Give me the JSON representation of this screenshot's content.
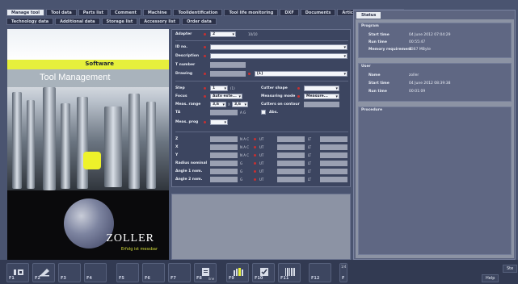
{
  "tabs_row1": [
    "Manage tool",
    "Tool data",
    "Parts list",
    "Comment",
    "Machine",
    "ToolIdentification",
    "Tool life monitoring",
    "DXF",
    "Documents",
    "Article characteristic bar"
  ],
  "tabs_row2": [
    "Technology data",
    "Additional data",
    "Storage list",
    "Accessory list",
    "Order data"
  ],
  "left": {
    "software_label": "Software",
    "title": "Tool Management",
    "logo": "ZOLLER",
    "slogan": "Erfolg ist messbar"
  },
  "form": {
    "adapter_label": "Adapter",
    "adapter_value": "2",
    "adapter_count": "10/10",
    "id_label": "ID no.",
    "description_label": "Description",
    "t_number_label": "T number",
    "drawing_label": "Drawing",
    "drawing_value": "[1]",
    "step_label": "Step",
    "step_value": "1",
    "step_count": "(1)",
    "focus_label": "Focus",
    "focus_value": "Auto exte...",
    "meas_range_label": "Meas. range",
    "meas_range_a": "3,6",
    "meas_range_x": "X",
    "meas_range_b": "3,6",
    "ta_label": "TA",
    "ta_suffix": "A G",
    "meas_prog_label": "Meas. prog",
    "cutter_shape_label": "Cutter shape",
    "measuring_mode_label": "Measuring mode",
    "measuring_mode_value": "Measure...",
    "cutters_contour_label": "Cutters on contour",
    "abs_label": "Abs.",
    "z_label": "Z",
    "x_label": "X",
    "y_label": "Y",
    "radius_label": "Radius nominal",
    "angle1_label": "Angle 1 nom.",
    "angle2_label": "Angle 2 nom.",
    "nac": "N A C",
    "ut": "UT",
    "lt": "LT",
    "g": "G"
  },
  "status": {
    "tab": "Status",
    "program_title": "Program",
    "program": [
      {
        "k": "Start time",
        "v": "04 June 2012 07:04:29"
      },
      {
        "k": "Run time",
        "v": "00:55:47"
      },
      {
        "k": "Memory requirement",
        "v": "1367 MByte"
      }
    ],
    "user_title": "User",
    "user": [
      {
        "k": "Name",
        "v": "zoller"
      },
      {
        "k": "Start time",
        "v": "04 June 2012 08:39:38"
      },
      {
        "k": "Run time",
        "v": "00:01:09"
      }
    ],
    "procedure_title": "Procedure"
  },
  "fkeys": [
    "F1",
    "F2",
    "F3",
    "F4",
    "F5",
    "F6",
    "F7",
    "F8",
    "F9",
    "F10",
    "F11",
    "F12",
    "F"
  ],
  "f8_sub": "line",
  "fsmall_top": "1/4",
  "right_buttons": {
    "help": "Help",
    "side": "Ste"
  }
}
